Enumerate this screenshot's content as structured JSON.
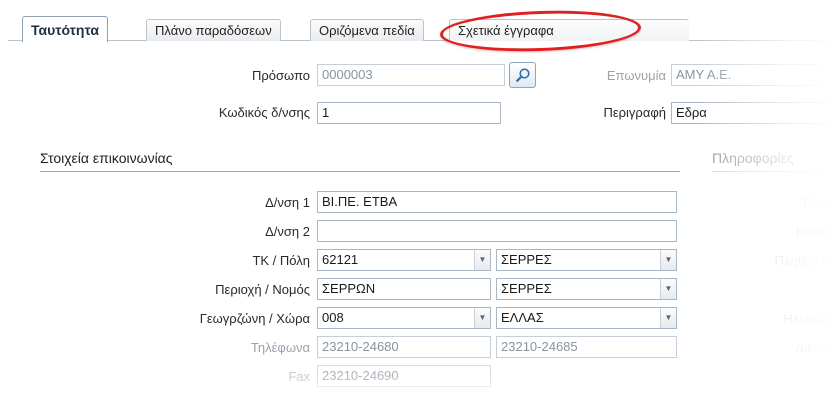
{
  "tabs": [
    {
      "label": "Ταυτότητα",
      "active": true
    },
    {
      "label": "Πλάνο παραδόσεων",
      "active": false
    },
    {
      "label": "Οριζόμενα πεδία",
      "active": false
    },
    {
      "label": "Σχετικά έγγραφα",
      "active": false,
      "highlighted": true
    }
  ],
  "header": {
    "person_label": "Πρόσωπο",
    "person_value": "0000003",
    "name_label": "Επωνυμία",
    "name_value": "AMY A.E.",
    "address_code_label": "Κωδικός δ/νσης",
    "address_code_value": "1",
    "description_label": "Περιγραφή",
    "description_value": "Εδρα"
  },
  "contact": {
    "title": "Στοιχεία επικοινωνίας",
    "address1_label": "Δ/νση 1",
    "address1_value": "ΒΙ.ΠΕ. ΕΤΒΑ",
    "address2_label": "Δ/νση 2",
    "address2_value": "",
    "zip_city_label": "ΤΚ / Πόλη",
    "zip_value": "62121",
    "city_value": "ΣΕΡΡΕΣ",
    "area_prefecture_label": "Περιοχή / Νομός",
    "area_value": "ΣΕΡΡΩΝ",
    "prefecture_value": "ΣΕΡΡΕΣ",
    "geozone_country_label": "Γεωγρζώνη / Χώρα",
    "geozone_value": "008",
    "country_value": "ΕΛΛΑΣ",
    "phones_label": "Τηλέφωνα",
    "phone1_value": "23210-24680",
    "phone2_value": "23210-24685",
    "fax_label": "Fax",
    "fax_value": "23210-24690"
  },
  "info": {
    "title": "Πληροφορίες",
    "labels": [
      "Προτε",
      "Καθεστ",
      "Πλήθος υπ",
      "Ε",
      "Ηλεκτρον",
      "Δικτυοτ"
    ]
  },
  "colors": {
    "highlight": "#e02020",
    "border": "#a9b6c4"
  },
  "icons": {
    "search": "magnifier-icon",
    "dropdown": "chevron-down-icon"
  }
}
